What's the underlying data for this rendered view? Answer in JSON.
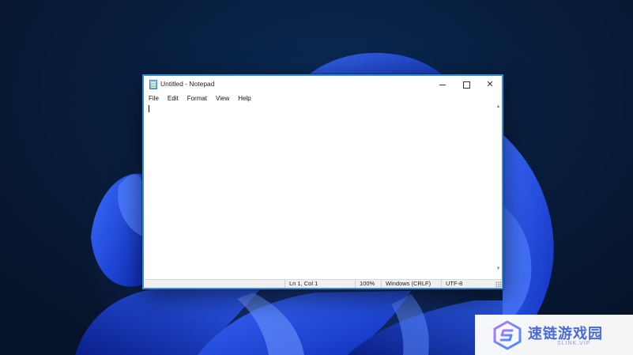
{
  "window": {
    "title": "Untitled - Notepad",
    "controls": {
      "minimize": "minimize-icon",
      "maximize": "maximize-icon",
      "close": "✕"
    }
  },
  "menu": [
    "File",
    "Edit",
    "Format",
    "View",
    "Help"
  ],
  "editor": {
    "text": ""
  },
  "status": {
    "position": "Ln 1, Col 1",
    "zoom": "100%",
    "line_ending": "Windows (CRLF)",
    "encoding": "UTF-8"
  },
  "watermark": {
    "name": "速链游戏园",
    "domain": "SLINK.VIP"
  },
  "colors": {
    "window_border": "#2f8fd6",
    "desktop_bg": "#0a1a33",
    "bloom": "#1e4fe0",
    "watermark_text": "#4a6bd6"
  }
}
